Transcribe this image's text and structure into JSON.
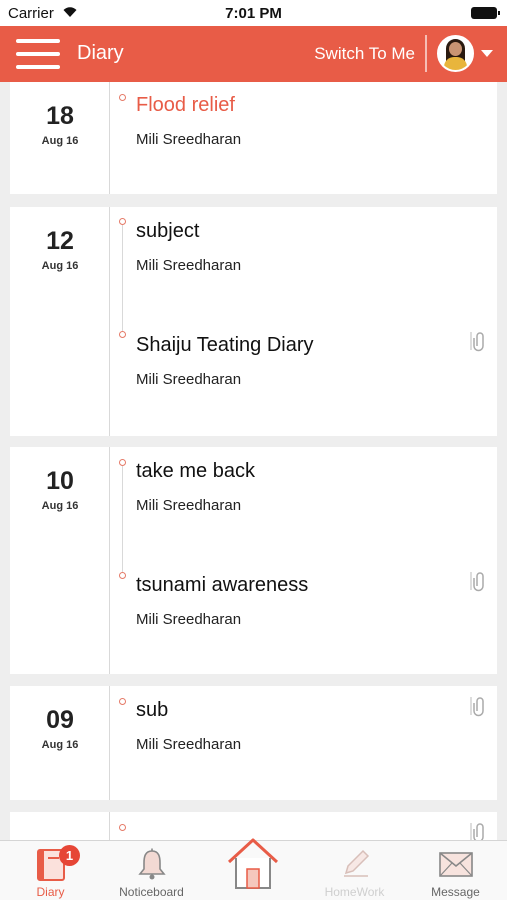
{
  "status_bar": {
    "carrier": "Carrier",
    "time": "7:01 PM"
  },
  "header": {
    "title": "Diary",
    "switch_label": "Switch To Me"
  },
  "diary_groups": [
    {
      "day": "18",
      "month": "Aug 16",
      "entries": [
        {
          "subject": "Flood relief",
          "author": "Mili Sreedharan",
          "attachment": false,
          "active": true
        }
      ]
    },
    {
      "day": "12",
      "month": "Aug 16",
      "entries": [
        {
          "subject": "subject",
          "author": "Mili Sreedharan",
          "attachment": false
        },
        {
          "subject": "Shaiju Teating Diary",
          "author": "Mili Sreedharan",
          "attachment": true
        }
      ]
    },
    {
      "day": "10",
      "month": "Aug 16",
      "entries": [
        {
          "subject": "take me back",
          "author": "Mili Sreedharan",
          "attachment": false
        },
        {
          "subject": "tsunami awareness",
          "author": "Mili Sreedharan",
          "attachment": true
        }
      ]
    },
    {
      "day": "09",
      "month": "Aug 16",
      "entries": [
        {
          "subject": "sub",
          "author": "Mili Sreedharan",
          "attachment": true
        }
      ]
    }
  ],
  "tab_bar": {
    "diary": {
      "label": "Diary",
      "badge": "1"
    },
    "noticeboard": {
      "label": "Noticeboard"
    },
    "homework": {
      "label": "HomeWork"
    },
    "message": {
      "label": "Message"
    }
  },
  "colors": {
    "accent": "#e85c47",
    "tab_active": "#e85c47",
    "tab_inactive": "#888888",
    "tab_disabled": "#cfcfcf"
  }
}
